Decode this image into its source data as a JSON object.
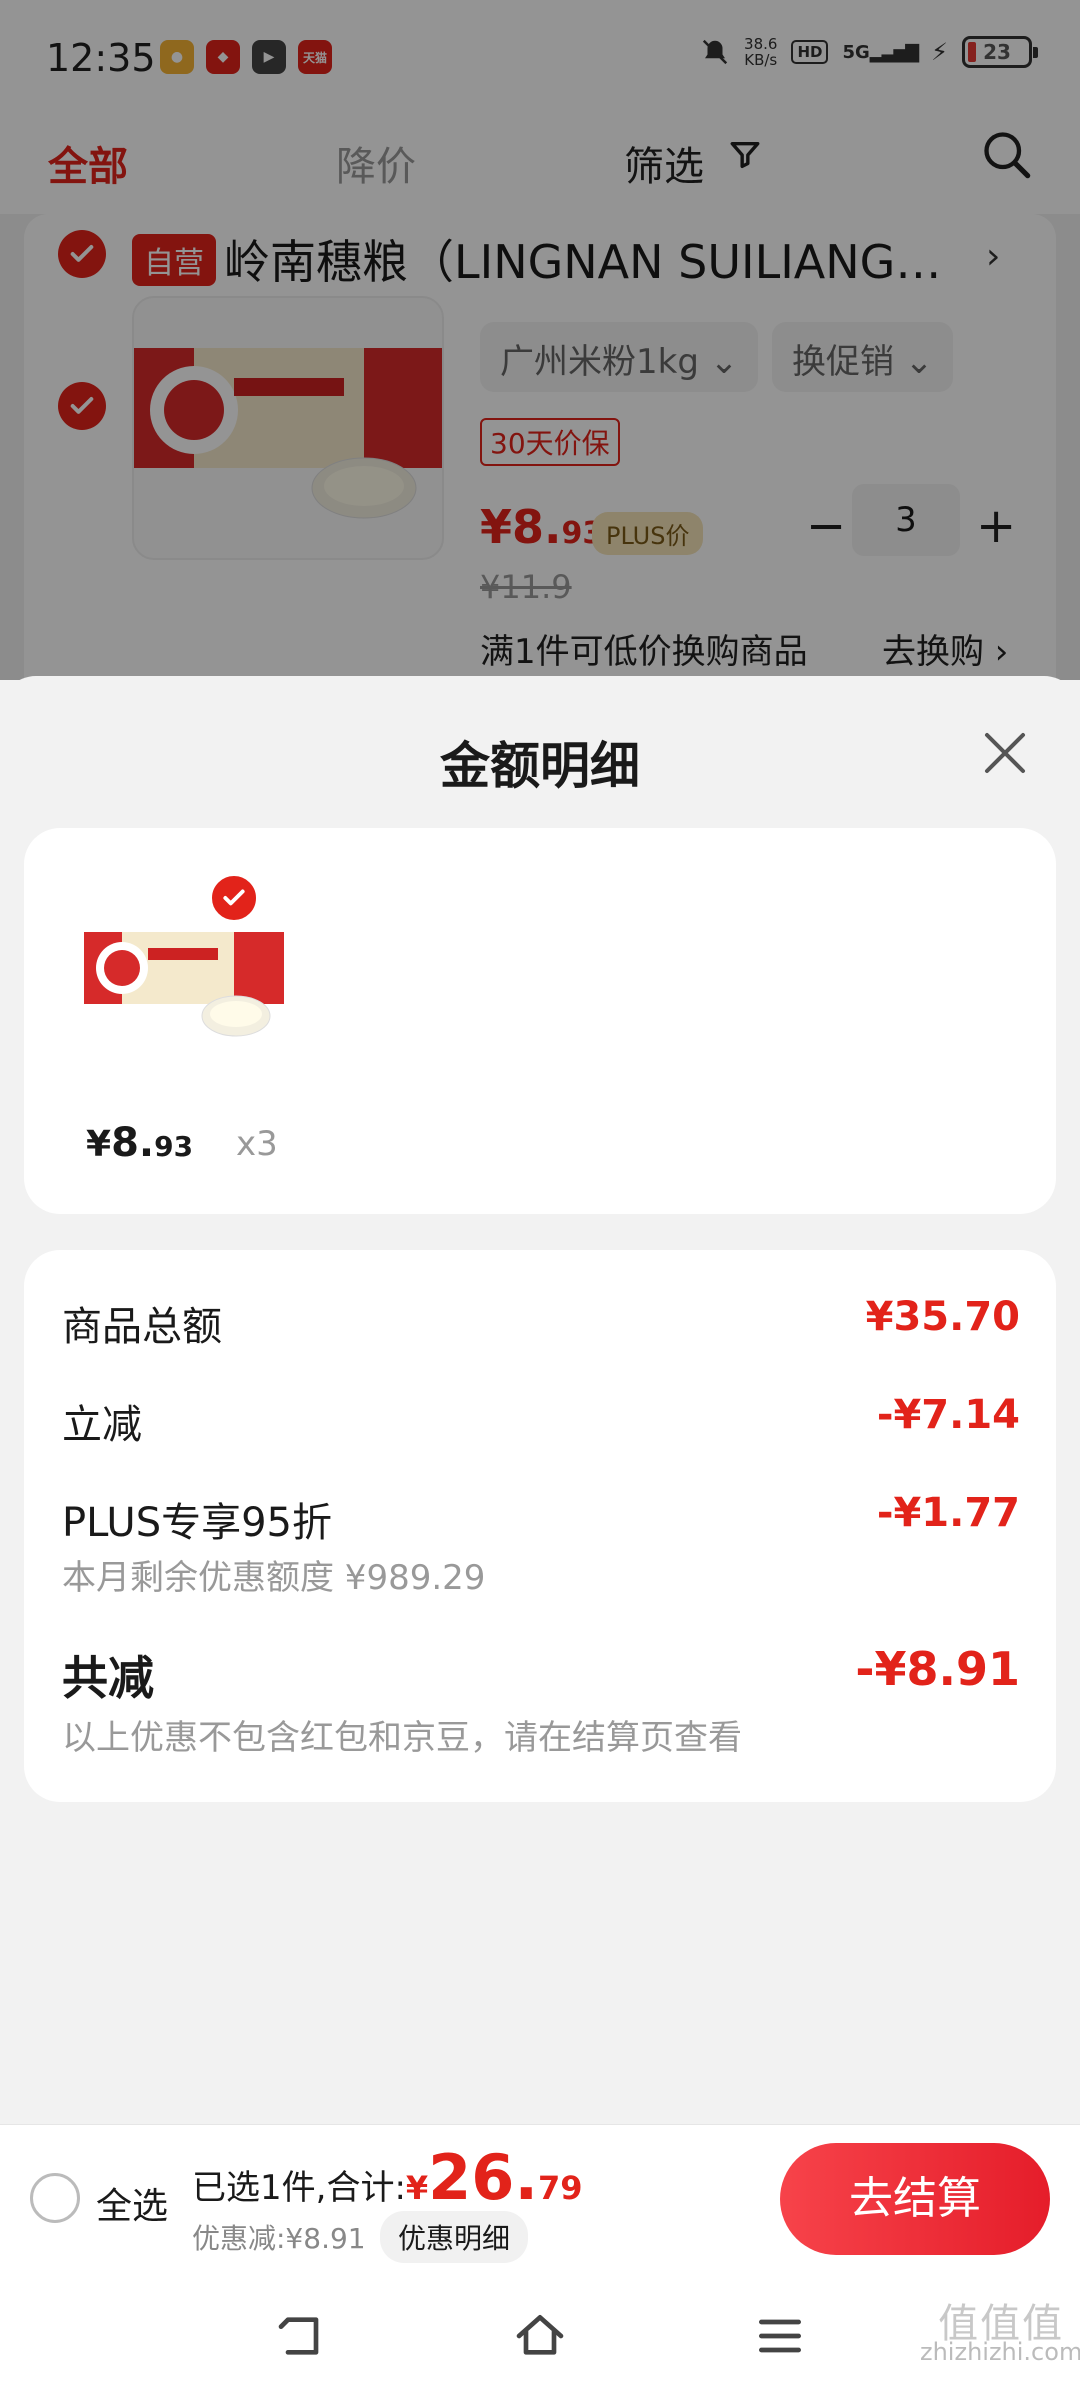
{
  "status_bar": {
    "time": "12:35",
    "network_speed": "38.6",
    "network_unit": "KB/s",
    "hd": "HD",
    "signal": "5G",
    "battery": "23",
    "app_icons": [
      "app-icon-1",
      "app-icon-2",
      "play-app-icon",
      "tmall-app-icon"
    ],
    "tmall_label": "天猫"
  },
  "tabs": {
    "all": "全部",
    "price_drop": "降价",
    "filter": "筛选"
  },
  "cart_item": {
    "self_operated_tag": "自营",
    "shop_name": "岭南穗粮（LINGNAN SUILIANG…",
    "spec": "广州米粉1kg",
    "promo": "换促销",
    "price_guard": "30天价保",
    "price_int": "¥8.",
    "price_dec": "93",
    "plus_tag": "PLUS价",
    "quantity": "3",
    "minus": "−",
    "plus": "+",
    "original_price": "¥11.9",
    "exchange_text": "满1件可低价换购商品",
    "exchange_link": "去换购 ›"
  },
  "sheet": {
    "title": "金额明细",
    "goods": {
      "currency": "¥",
      "price_int": "8.",
      "price_dec": "93",
      "quantity": "x3"
    },
    "details": {
      "goods_total_label": "商品总额",
      "goods_total_value": "¥35.70",
      "instant_discount_label": "立减",
      "instant_discount_value": "-¥7.14",
      "plus_label": "PLUS专享95折",
      "plus_value": "-¥1.77",
      "plus_sub": "本月剩余优惠额度 ¥989.29",
      "total_label": "共减",
      "total_value": "-¥8.91",
      "note": "以上优惠不包含红包和京豆，请在结算页查看"
    }
  },
  "footer": {
    "select_all": "全选",
    "selected_text": "已选1件,合计:",
    "currency": "¥",
    "total_int": "26.",
    "total_dec": "79",
    "discount_text": "优惠减:¥8.91",
    "discount_detail_btn": "优惠明细",
    "checkout": "去结算"
  },
  "watermark": {
    "line1": "值值值",
    "line2": "zhizhizhi.com"
  },
  "colors": {
    "brand_red": "#e2231a",
    "plus_gold": "#f5e4b8"
  }
}
